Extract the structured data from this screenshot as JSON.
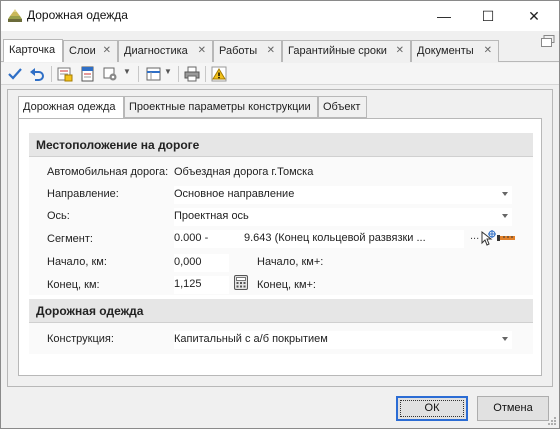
{
  "window": {
    "title": "Дорожная одежда",
    "icon": "road-layers-icon",
    "controls": {
      "minimize": "—",
      "maximize": "☐",
      "close": "✕"
    }
  },
  "doc_tabs": [
    {
      "label": "Карточка",
      "active": true,
      "closable": false
    },
    {
      "label": "Слои",
      "closable": true
    },
    {
      "label": "Диагностика",
      "closable": true
    },
    {
      "label": "Работы",
      "closable": true
    },
    {
      "label": "Гарантийные сроки",
      "closable": true
    },
    {
      "label": "Документы",
      "closable": true
    }
  ],
  "toolbar": {
    "icons": [
      "checkmark-icon",
      "undo-icon",
      "report-icon",
      "card-icon",
      "print-settings-icon",
      "dropdown-arrow-icon",
      "layout-icon",
      "dropdown-arrow-icon",
      "printer-icon",
      "warning-icon"
    ]
  },
  "sub_tabs": [
    {
      "label": "Дорожная одежда",
      "active": true
    },
    {
      "label": "Проектные параметры конструкции"
    },
    {
      "label": "Объект"
    }
  ],
  "location": {
    "header": "Местоположение на дороге",
    "road_label": "Автомобильная дорога:",
    "road_value": "Объездная дорога г.Томска",
    "direction_label": "Направление:",
    "direction_value": "Основное направление",
    "axis_label": "Ось:",
    "axis_value": "Проектная ось",
    "segment_label": "Сегмент:",
    "segment_start": "0.000 -",
    "segment_value": "9.643 (Конец кольцевой развязки ...",
    "segment_more": "...",
    "start_label": "Начало, км:",
    "start_value": "0,000",
    "start_plus_label": "Начало, км+:",
    "end_label": "Конец, км:",
    "end_value": "1,125",
    "end_plus_label": "Конец, км+:"
  },
  "pavement": {
    "header": "Дорожная одежда",
    "construction_label": "Конструкция:",
    "construction_value": "Капитальный с а/б покрытием"
  },
  "buttons": {
    "ok": "ОК",
    "cancel": "Отмена"
  },
  "colors": {
    "accent": "#2b6cd4",
    "warning": "#f3c21b",
    "ruler": "#e0802a"
  }
}
